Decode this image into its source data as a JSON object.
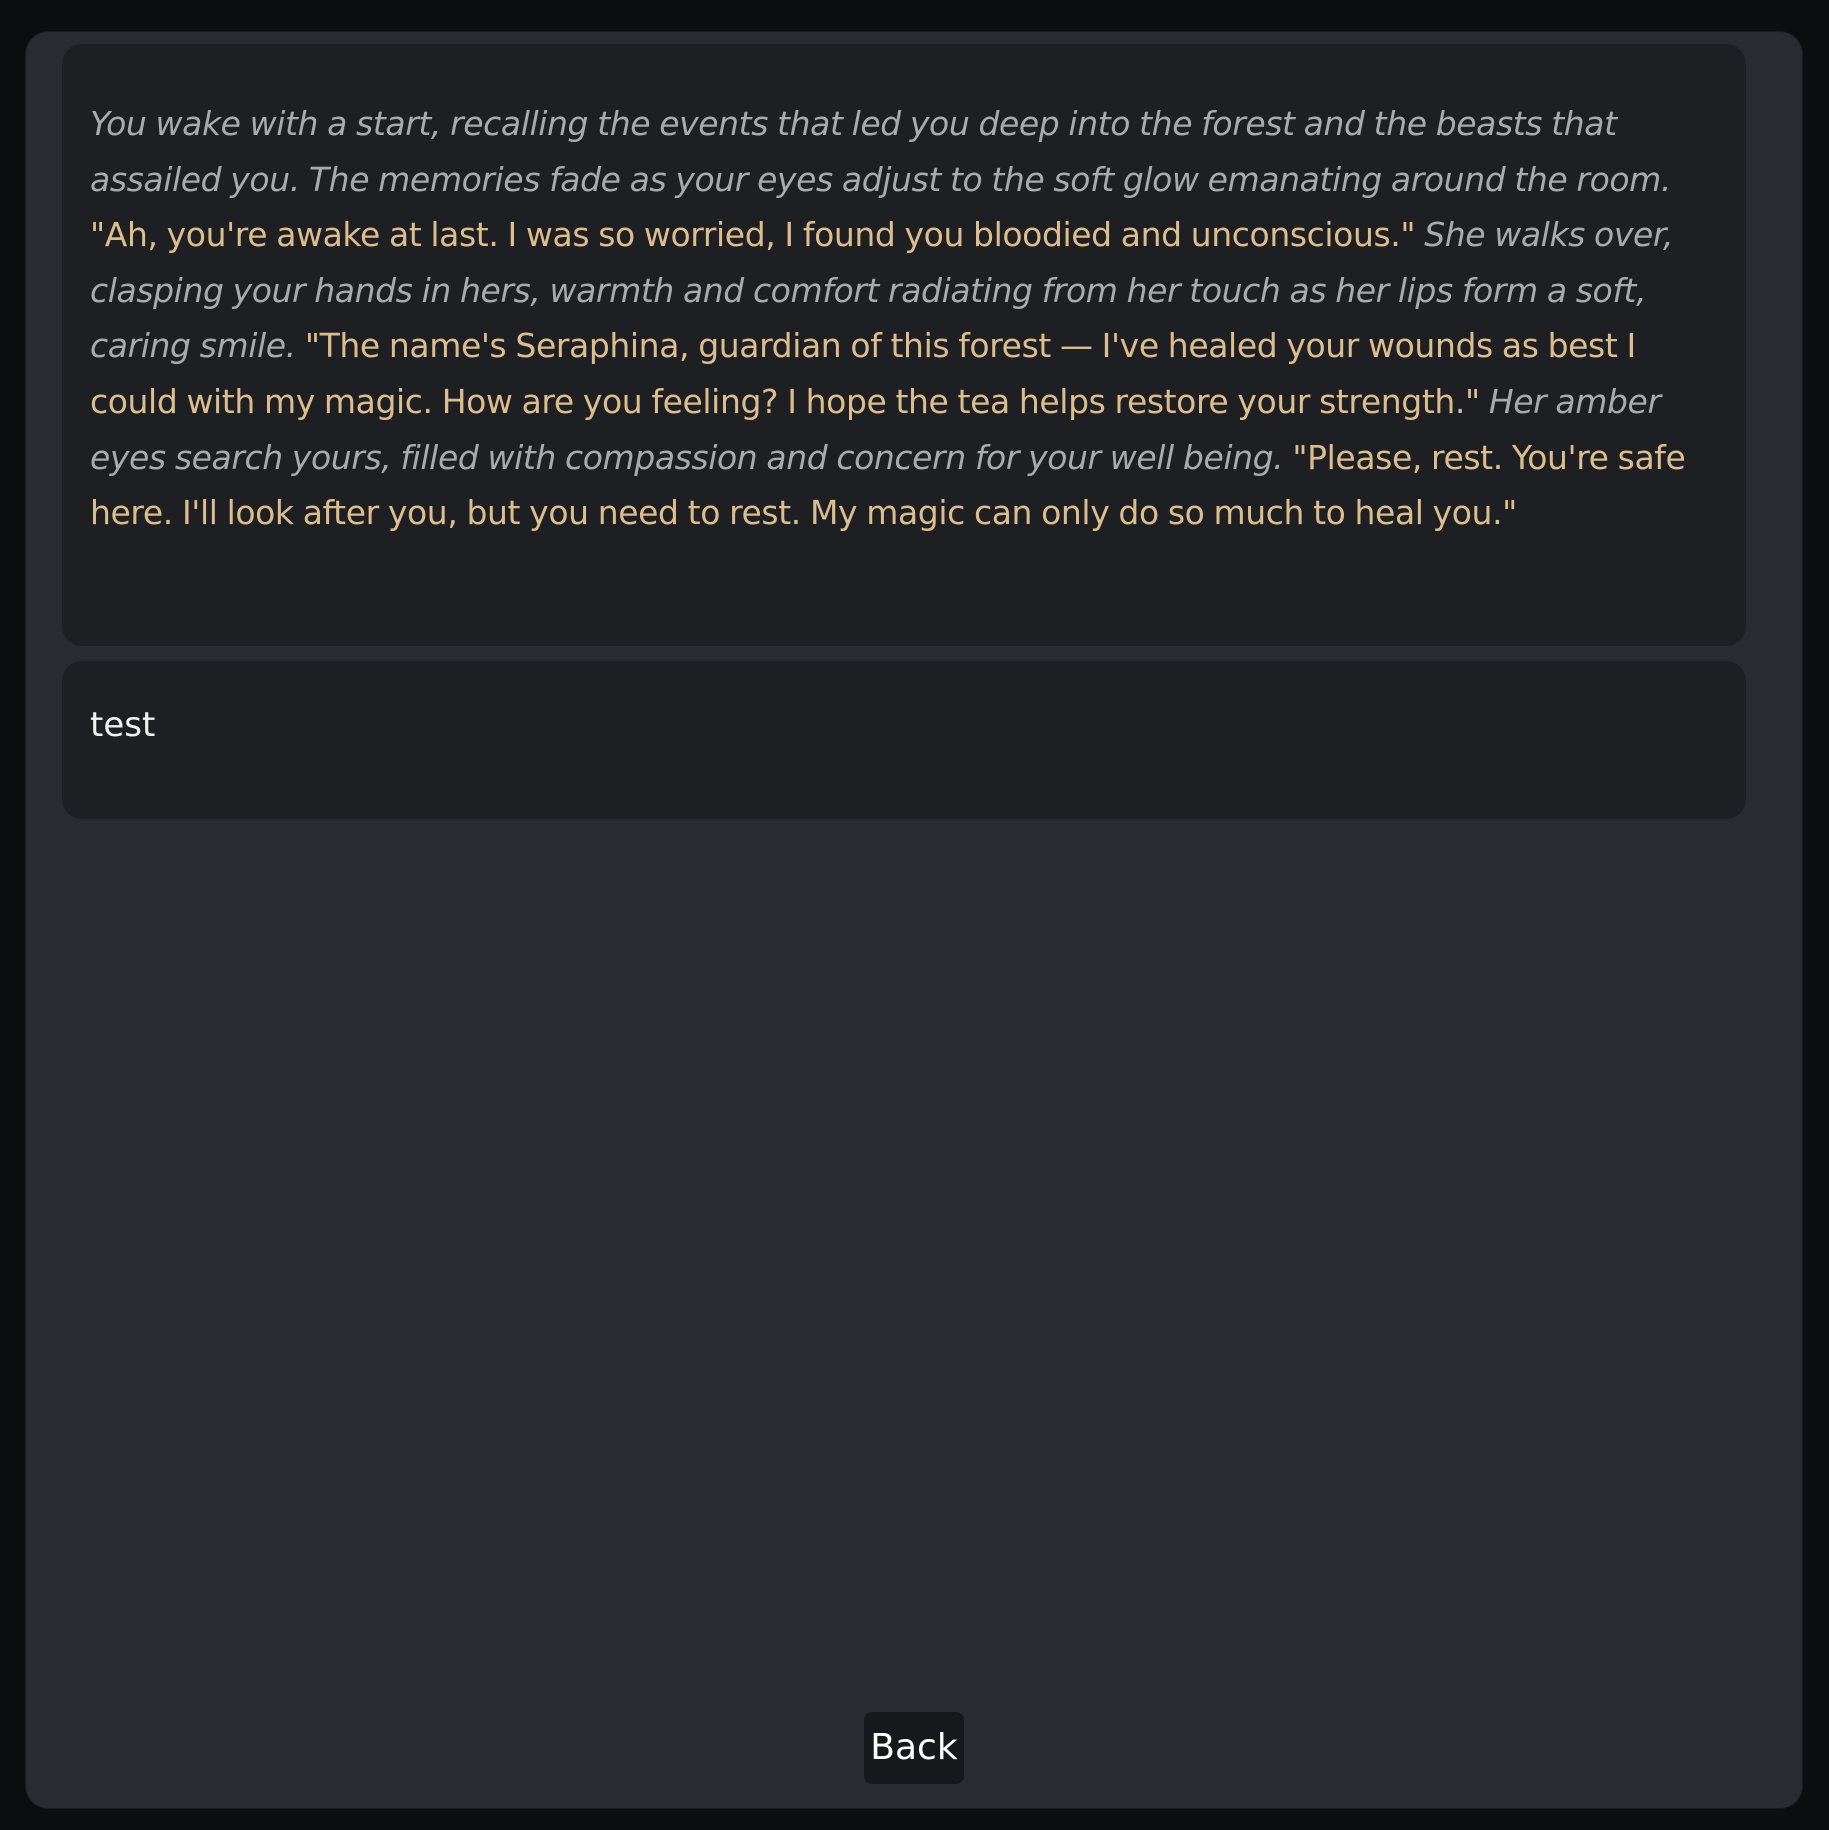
{
  "chat": {
    "messages": [
      {
        "role": "character",
        "segments": [
          {
            "style": "narration",
            "text": "You wake with a start, recalling the events that led you deep into the forest and the beasts that assailed you. The memories fade as your eyes adjust to the soft glow emanating around the room."
          },
          {
            "style": "dialogue",
            "text": "\"Ah, you're awake at last. I was so worried, I found you bloodied and unconscious.\""
          },
          {
            "style": "narration",
            "text": "She walks over, clasping your hands in hers, warmth and comfort radiating from her touch as her lips form a soft, caring smile."
          },
          {
            "style": "dialogue",
            "text": "\"The name's Seraphina, guardian of this forest — I've healed your wounds as best I could with my magic. How are you feeling? I hope the tea helps restore your strength.\""
          },
          {
            "style": "narration",
            "text": "Her amber eyes search yours, filled with compassion and concern for your well being."
          },
          {
            "style": "dialogue",
            "text": "\"Please, rest. You're safe here. I'll look after you, but you need to rest. My magic can only do so much to heal you.\""
          }
        ]
      },
      {
        "role": "user",
        "text": "test"
      }
    ]
  },
  "controls": {
    "back_label": "Back"
  },
  "colors": {
    "page_background": "#0c0d0f",
    "panel_background": "#2a2b31",
    "message_background": "#1e1f23",
    "narration_text": "#a9a9ae",
    "dialogue_text": "#dcbd8e",
    "user_text": "#f1f1f2",
    "button_background": "#17181b"
  }
}
